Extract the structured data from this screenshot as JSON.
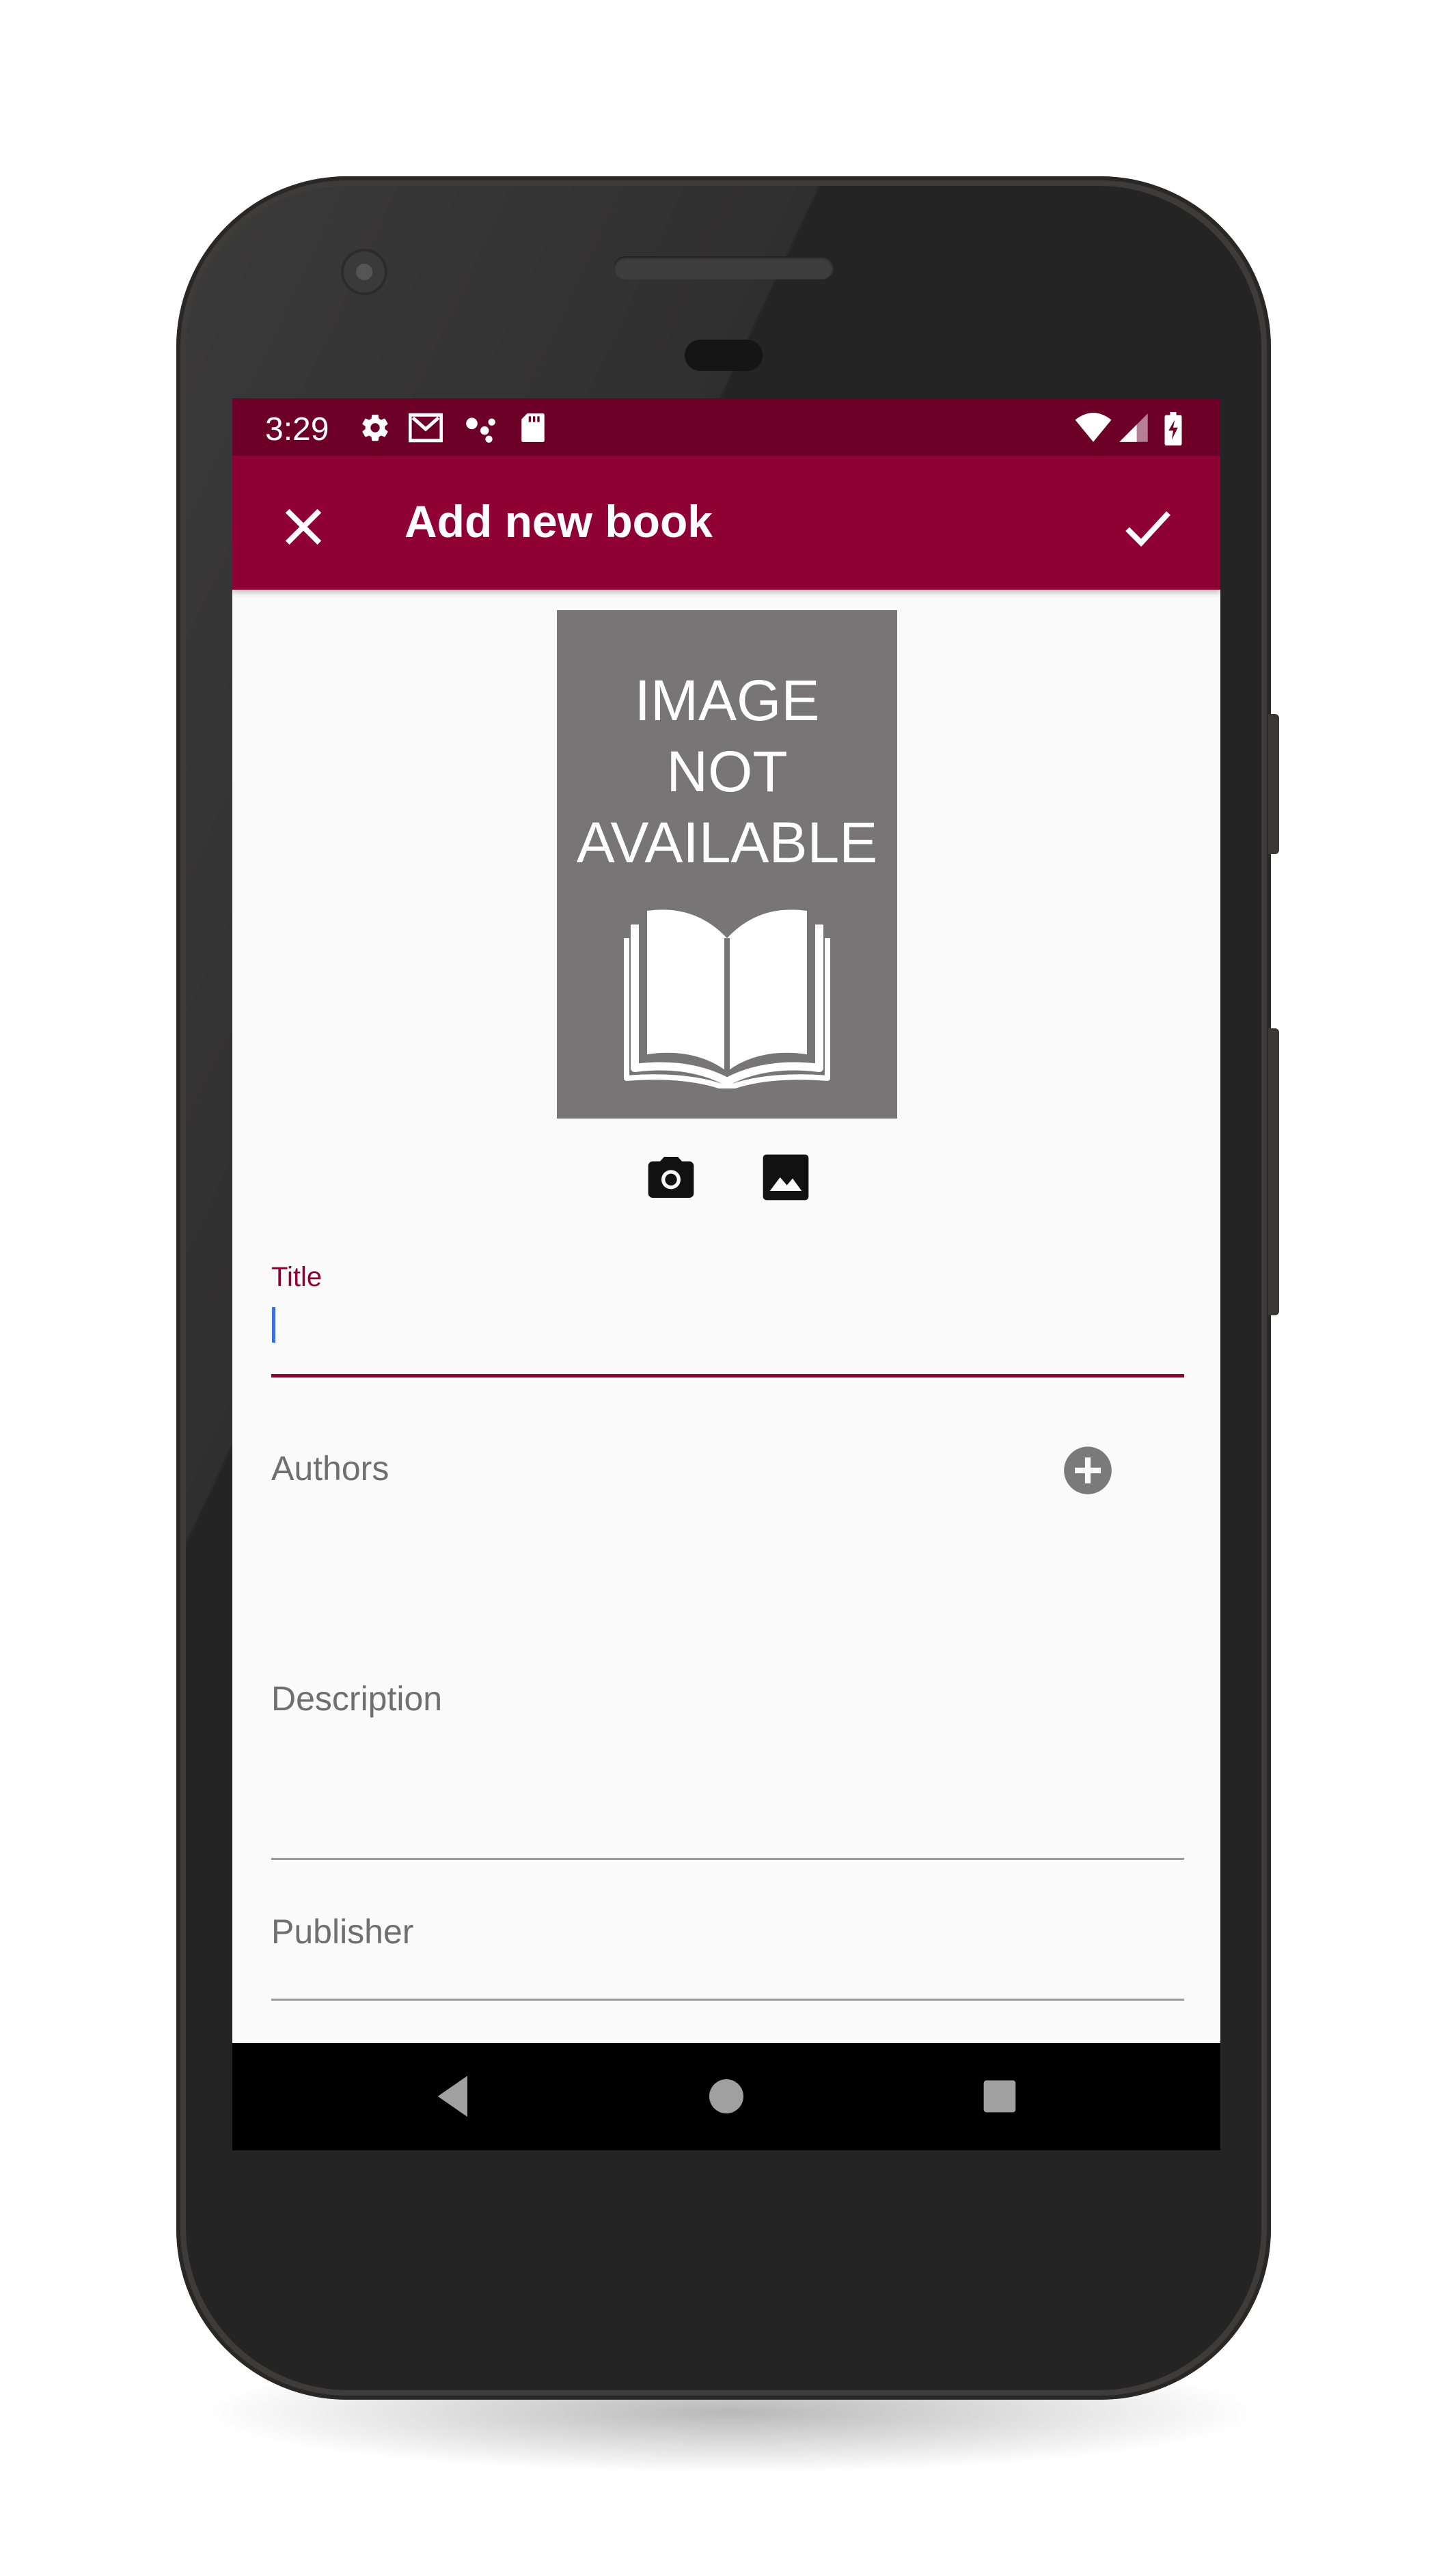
{
  "status_bar": {
    "time": "3:29",
    "icons": [
      "settings-icon",
      "gmail-icon",
      "assistant-dots-icon",
      "sd-card-icon",
      "wifi-icon",
      "signal-icon",
      "battery-charging-icon"
    ]
  },
  "toolbar": {
    "title": "Add new book",
    "close_icon": "close-icon",
    "save_icon": "check-icon"
  },
  "cover": {
    "line1": "IMAGE",
    "line2": "NOT",
    "line3": "AVAILABLE",
    "icons": [
      "camera-icon",
      "gallery-icon"
    ]
  },
  "form": {
    "title_label": "Title",
    "title_value": "",
    "authors_label": "Authors",
    "description_label": "Description",
    "publisher_label": "Publisher"
  },
  "colors": {
    "primary": "#8f0033",
    "primary_dark": "#6d0026",
    "accent_cursor": "#3d6fe0",
    "cover_gray": "#777576"
  },
  "nav_bar": {
    "icons": [
      "back-icon",
      "home-icon",
      "recents-icon"
    ]
  }
}
